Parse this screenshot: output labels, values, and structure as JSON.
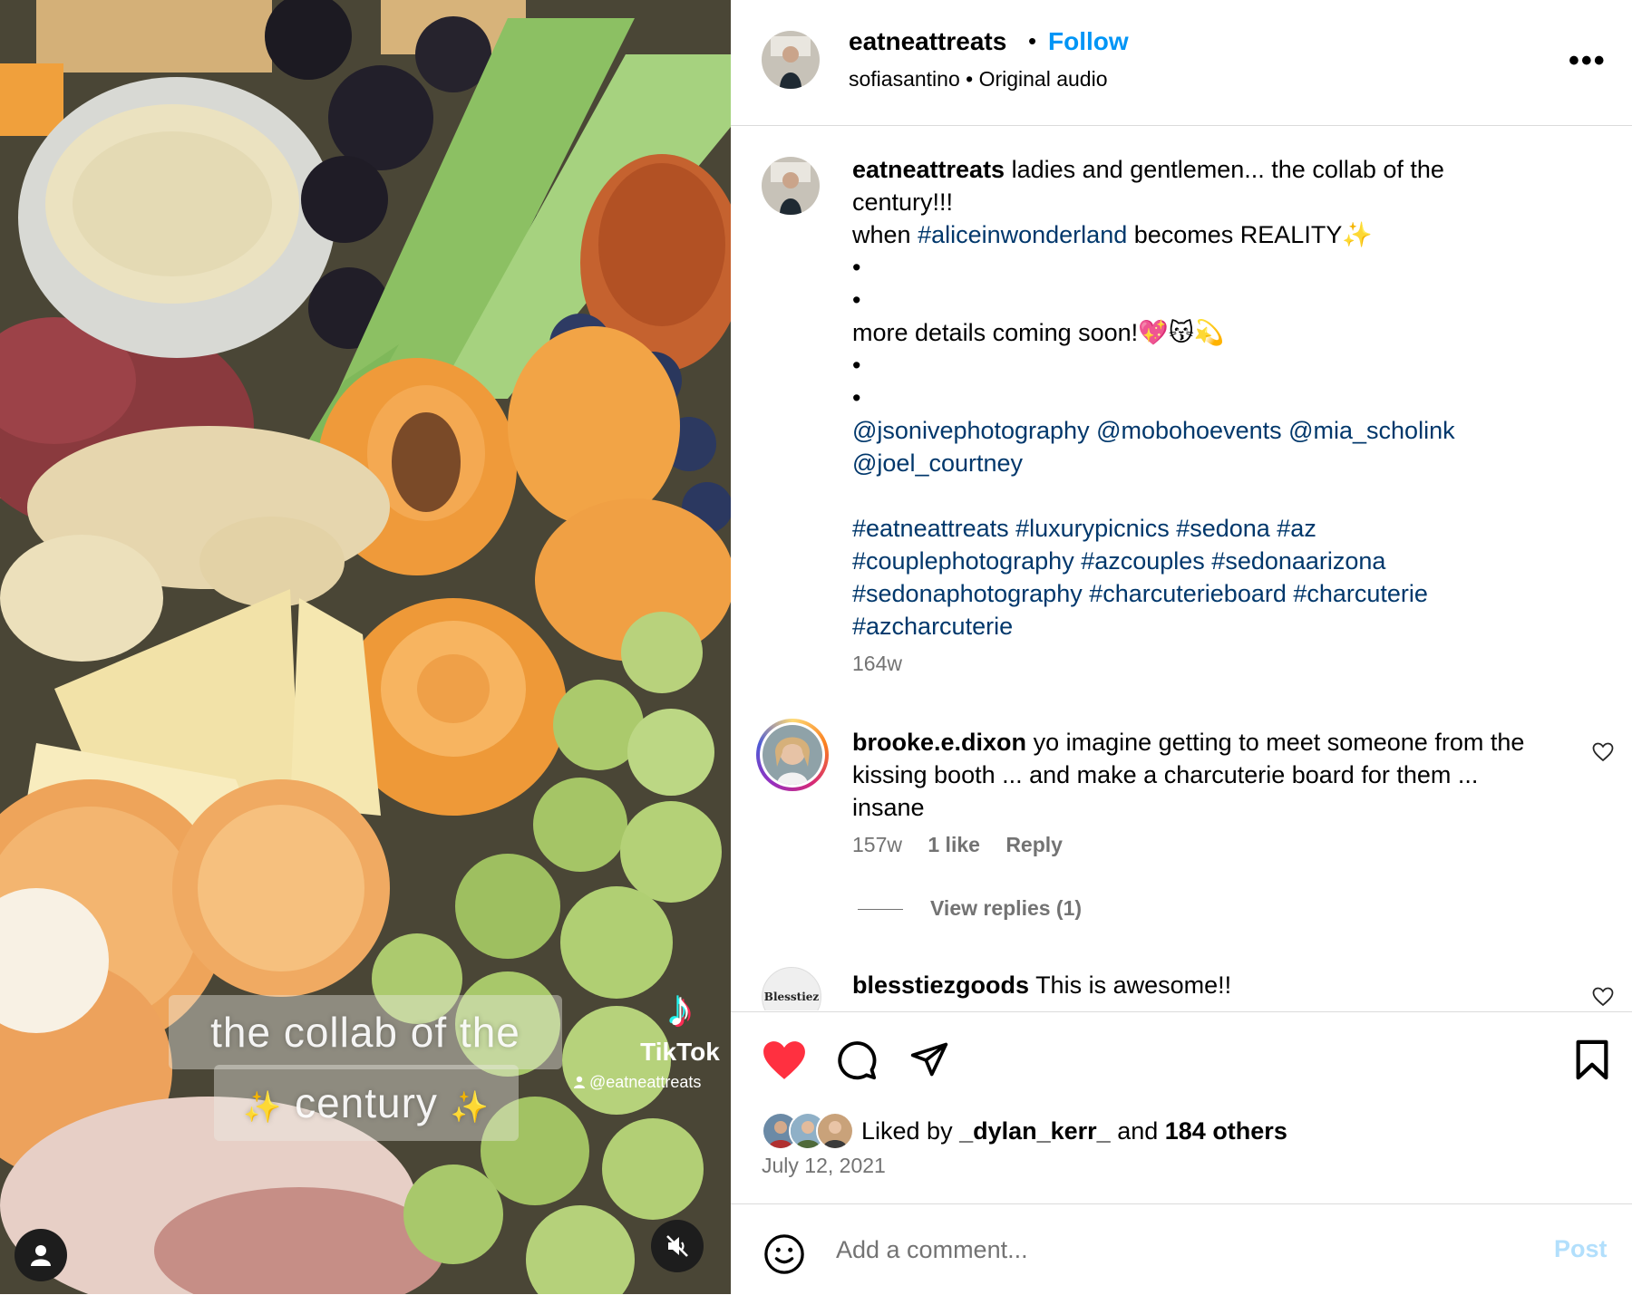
{
  "media": {
    "overlay_line1": "the collab of the",
    "overlay_line2": "century",
    "overlay_sparkle": "✨",
    "tiktok_logo": "♪",
    "tiktok_brand": "TikTok",
    "tiktok_handle": "@eatneattreats"
  },
  "header": {
    "username": "eatneattreats",
    "separator": "•",
    "follow_label": "Follow",
    "audio_line": "sofiasantino • Original audio",
    "more_label": "•••"
  },
  "caption": {
    "username": "eatneattreats",
    "line1": "ladies and gentlemen... the collab of the century!!!",
    "line2_pre": "when ",
    "line2_tag": "#aliceinwonderland",
    "line2_post": " becomes REALITY✨",
    "bullet": "•",
    "line3": "more details coming soon!💖😽💫",
    "mentions": "@jsonivephotography @mobohoevents @mia_scholink @joel_courtney",
    "hashtags": "#eatneattreats #luxurypicnics #sedona #az #couplephotography #azcouples #sedonaarizona #sedonaphotography #charcuterieboard #charcuterie #azcharcuterie",
    "time": "164w"
  },
  "comments": [
    {
      "username": "brooke.e.dixon",
      "text": "yo imagine getting to meet someone from the kissing booth ... and make a charcuterie board for them ... insane",
      "time": "157w",
      "likes": "1 like",
      "reply_label": "Reply",
      "view_replies": "View replies (1)"
    },
    {
      "username": "blesstiezgoods",
      "text": "This is awesome!!",
      "avatar_text": "Blesstiez"
    }
  ],
  "actions": {
    "liked_prefix": "Liked by ",
    "liked_user": "_dylan_kerr_",
    "liked_and": " and ",
    "liked_others": "184 others",
    "date": "July 12, 2021"
  },
  "add_comment": {
    "placeholder": "Add a comment...",
    "post_label": "Post"
  },
  "colors": {
    "link_blue": "#0095f6",
    "hashtag": "#00376b",
    "heart_red": "#ff3040",
    "muted": "#737373"
  }
}
